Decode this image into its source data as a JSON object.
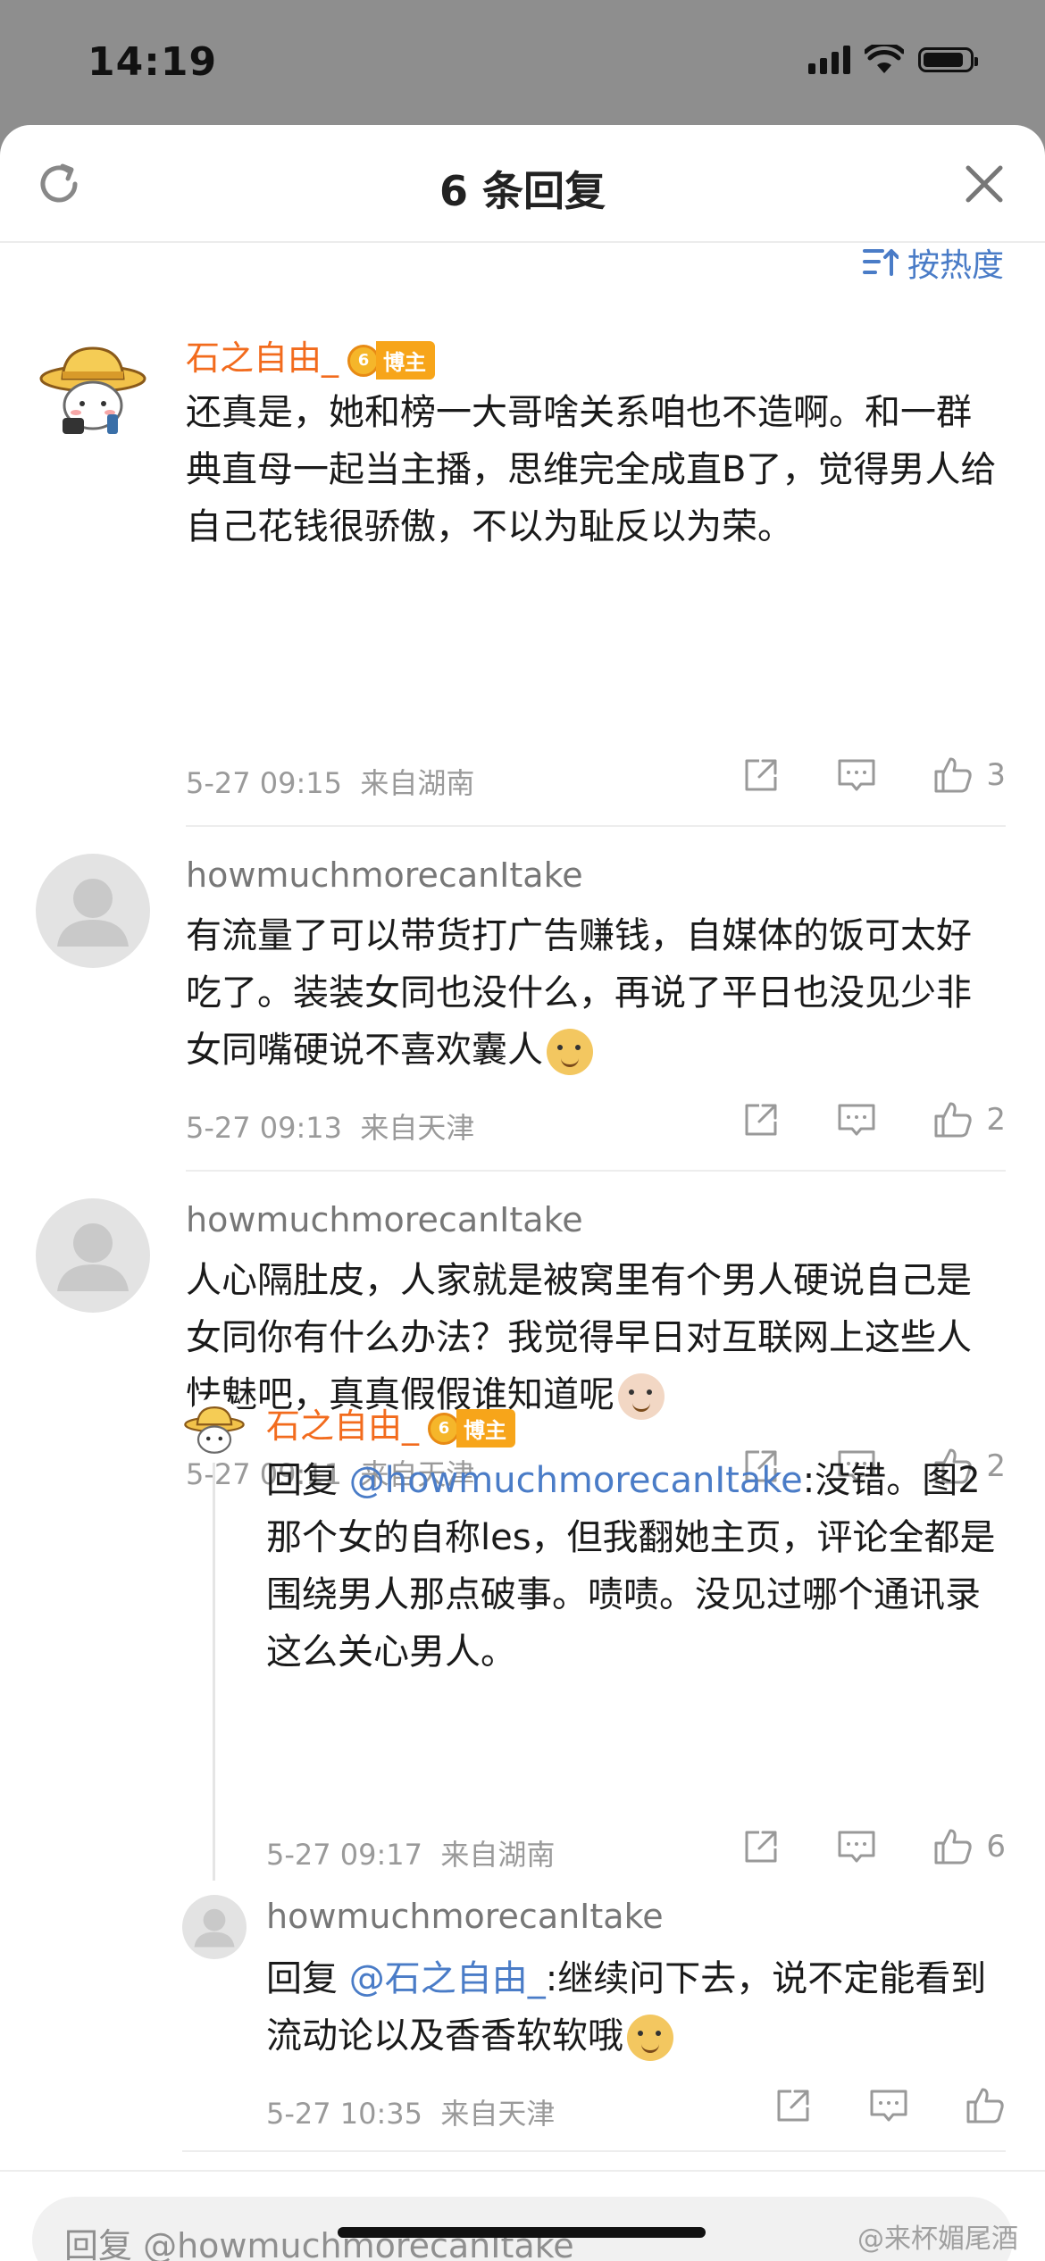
{
  "status_bar": {
    "time": "14:19"
  },
  "header": {
    "title": "6 条回复"
  },
  "sort": {
    "label": "按热度"
  },
  "comments": [
    {
      "name": "石之自由_",
      "badge": "博主",
      "badge_level": "6",
      "text": "还真是，她和榜一大哥啥关系咱也不造啊。和一群典直母一起当主播，思维完全成直B了，觉得男人给自己花钱很骄傲，不以为耻反以为荣。",
      "time": "5-27 09:15",
      "location": "来自湖南",
      "likes": "3"
    },
    {
      "name": "howmuchmorecanItake",
      "text": "有流量了可以带货打广告赚钱，自媒体的饭可太好吃了。装装女同也没什么，再说了平日也没见少非女同嘴硬说不喜欢囊人",
      "time": "5-27 09:13",
      "location": "来自天津",
      "likes": "2"
    },
    {
      "name": "howmuchmorecanItake",
      "text": "人心隔肚皮，人家就是被窝里有个男人硬说自己是女同你有什么办法？我觉得早日对互联网上这些人怯魅吧，真真假假谁知道呢",
      "time": "5-27 09:11",
      "location": "来自天津",
      "likes": "2"
    }
  ],
  "replies": [
    {
      "name": "石之自由_",
      "badge": "博主",
      "badge_level": "6",
      "prefix": "回复 ",
      "mention": "@howmuchmorecanItake",
      "text": ":没错。图2那个女的自称les，但我翻她主页，评论全都是围绕男人那点破事。啧啧。没见过哪个通讯录这么关心男人。",
      "time": "5-27 09:17",
      "location": "来自湖南",
      "likes": "6"
    },
    {
      "name": "howmuchmorecanItake",
      "prefix": "回复 ",
      "mention": "@石之自由_",
      "text": ":继续问下去，说不定能看到流动论以及香香软软哦",
      "time": "5-27 10:35",
      "location": "来自天津",
      "likes": ""
    }
  ],
  "input": {
    "placeholder": "回复 @howmuchmorecanItake"
  },
  "watermark": "@来杯媚尾酒",
  "colors": {
    "accent_blue": "#4a7cc7",
    "name_orange": "#f26b1d",
    "badge_gold": "#f7a51a"
  }
}
